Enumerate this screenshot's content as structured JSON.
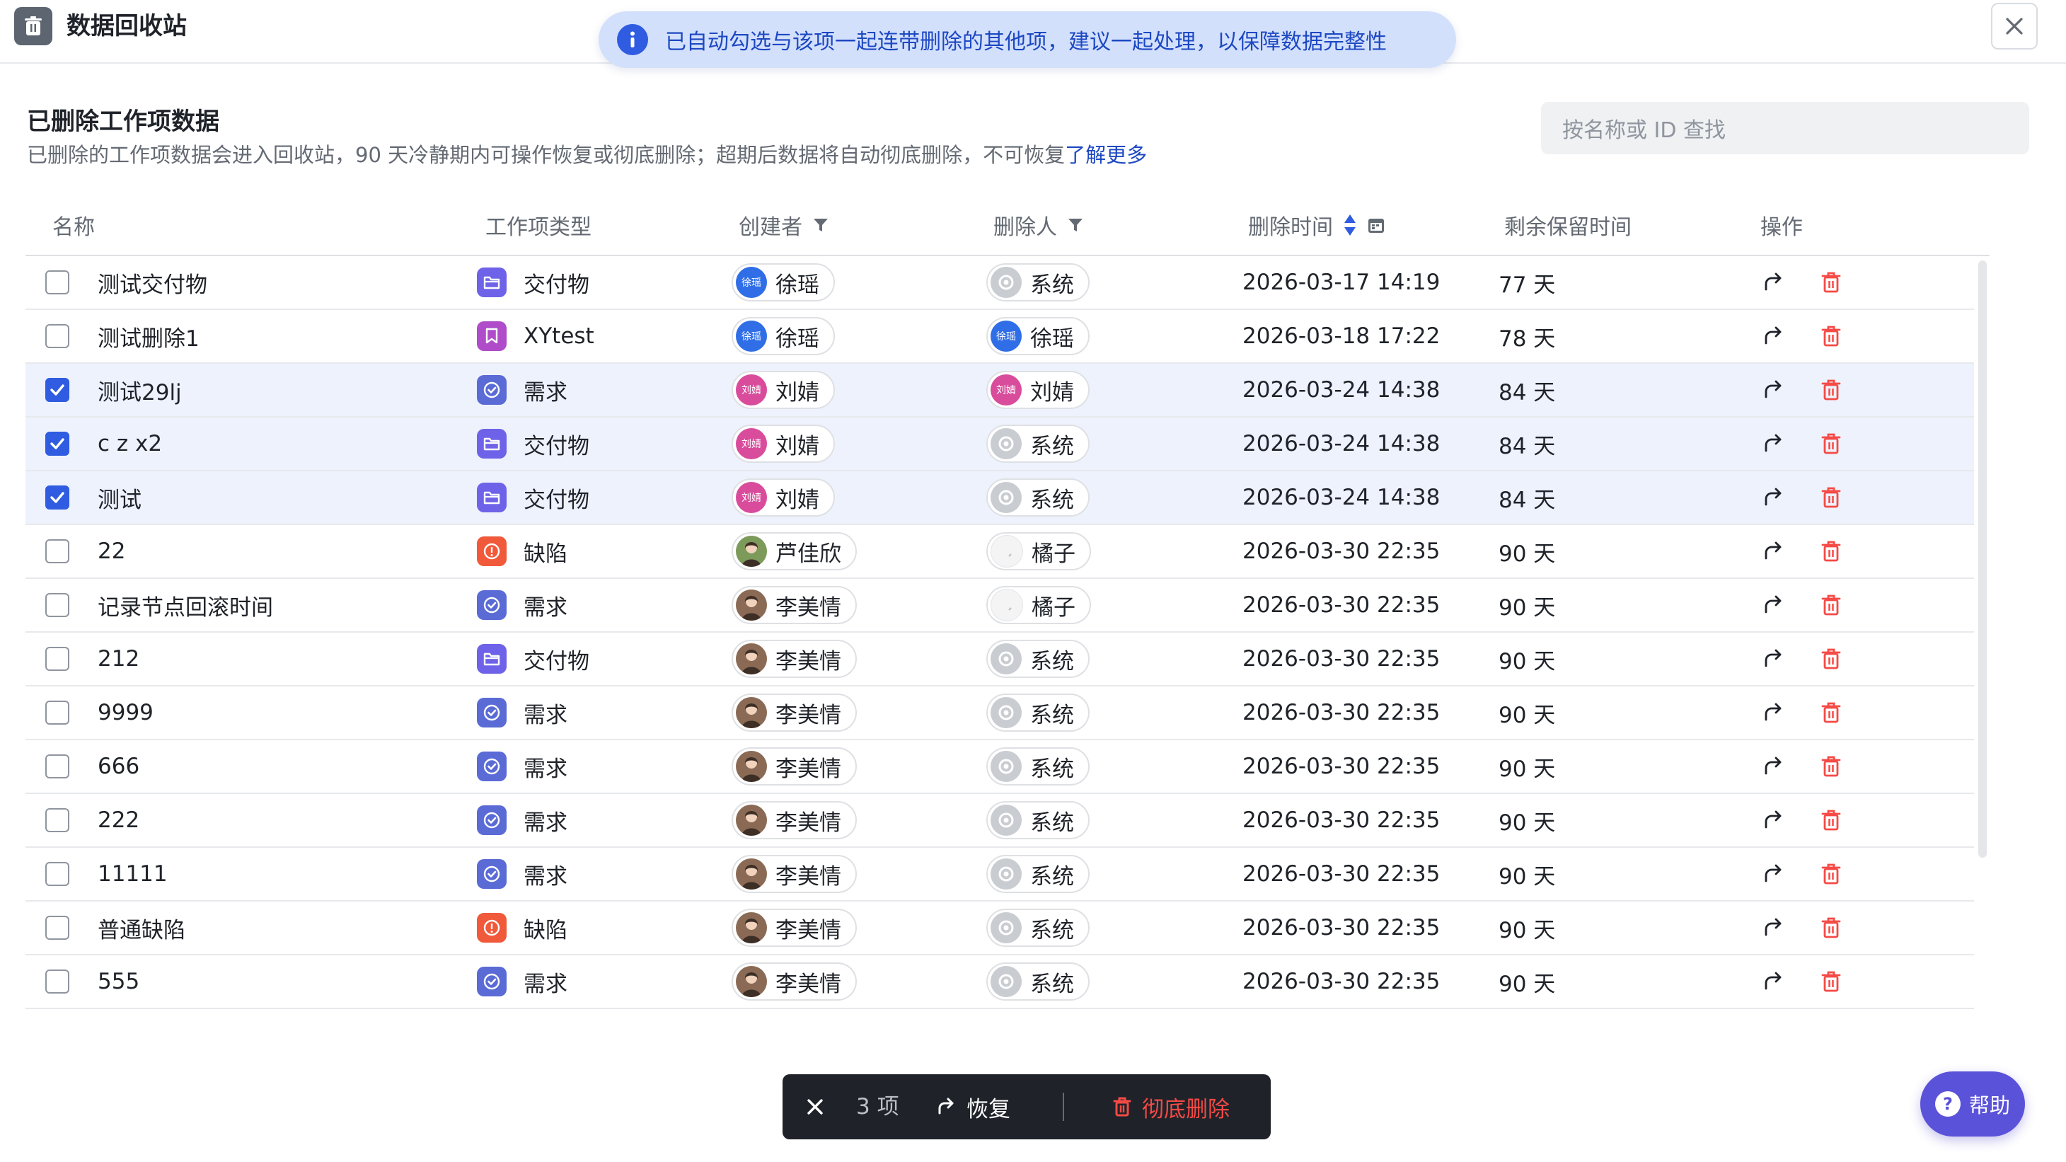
{
  "window": {
    "title": "数据回收站",
    "close_icon": "close-icon",
    "app_icon": "trash-icon"
  },
  "toast": {
    "icon": "info-icon",
    "text": "已自动勾选与该项一起连带删除的其他项，建议一起处理，以保障数据完整性"
  },
  "section": {
    "title": "已删除工作项数据",
    "description": "已删除的工作项数据会进入回收站，90 天冷静期内可操作恢复或彻底删除；超期后数据将自动彻底删除，不可恢复",
    "learn_more": "了解更多"
  },
  "search": {
    "placeholder": "按名称或 ID 查找"
  },
  "columns": {
    "name": "名称",
    "type": "工作项类型",
    "creator": "创建者",
    "deleter": "删除人",
    "deleted_at": "删除时间",
    "remaining": "剩余保留时间",
    "actions": "操作"
  },
  "type_colors": {
    "交付物": "#6e63e8",
    "XYtest": "#b04cc9",
    "需求": "#5a6bd6",
    "缺陷": "#f0593a"
  },
  "avatars": {
    "徐瑶": {
      "label": "徐瑶",
      "color": "#2f6ee6"
    },
    "刘婧": {
      "label": "刘婧",
      "color": "#d94c9c"
    },
    "芦佳欣": {
      "label": "",
      "color": "#7c9a5a"
    },
    "李美情": {
      "label": "",
      "color": "#8a6a54"
    },
    "系统": {
      "label": "",
      "color": "#c9ccd1"
    },
    "橘子": {
      "label": "",
      "color": "#f4f4f5"
    }
  },
  "rows": [
    {
      "name": "测试交付物",
      "type": "交付物",
      "creator": "徐瑶",
      "deleter": "系统",
      "deleted_at": "2026-03-17 14:19",
      "remaining": "77 天",
      "checked": false
    },
    {
      "name": "测试删除1",
      "type": "XYtest",
      "creator": "徐瑶",
      "deleter": "徐瑶",
      "deleted_at": "2026-03-18 17:22",
      "remaining": "78 天",
      "checked": false
    },
    {
      "name": "测试29lj",
      "type": "需求",
      "creator": "刘婧",
      "deleter": "刘婧",
      "deleted_at": "2026-03-24 14:38",
      "remaining": "84 天",
      "checked": true
    },
    {
      "name": "c z x2",
      "type": "交付物",
      "creator": "刘婧",
      "deleter": "系统",
      "deleted_at": "2026-03-24 14:38",
      "remaining": "84 天",
      "checked": true
    },
    {
      "name": "测试",
      "type": "交付物",
      "creator": "刘婧",
      "deleter": "系统",
      "deleted_at": "2026-03-24 14:38",
      "remaining": "84 天",
      "checked": true
    },
    {
      "name": "22",
      "type": "缺陷",
      "creator": "芦佳欣",
      "deleter": "橘子",
      "deleted_at": "2026-03-30 22:35",
      "remaining": "90 天",
      "checked": false
    },
    {
      "name": "记录节点回滚时间",
      "type": "需求",
      "creator": "李美情",
      "deleter": "橘子",
      "deleted_at": "2026-03-30 22:35",
      "remaining": "90 天",
      "checked": false
    },
    {
      "name": "212",
      "type": "交付物",
      "creator": "李美情",
      "deleter": "系统",
      "deleted_at": "2026-03-30 22:35",
      "remaining": "90 天",
      "checked": false
    },
    {
      "name": "9999",
      "type": "需求",
      "creator": "李美情",
      "deleter": "系统",
      "deleted_at": "2026-03-30 22:35",
      "remaining": "90 天",
      "checked": false
    },
    {
      "name": "666",
      "type": "需求",
      "creator": "李美情",
      "deleter": "系统",
      "deleted_at": "2026-03-30 22:35",
      "remaining": "90 天",
      "checked": false
    },
    {
      "name": "222",
      "type": "需求",
      "creator": "李美情",
      "deleter": "系统",
      "deleted_at": "2026-03-30 22:35",
      "remaining": "90 天",
      "checked": false
    },
    {
      "name": "11111",
      "type": "需求",
      "creator": "李美情",
      "deleter": "系统",
      "deleted_at": "2026-03-30 22:35",
      "remaining": "90 天",
      "checked": false
    },
    {
      "name": "普通缺陷",
      "type": "缺陷",
      "creator": "李美情",
      "deleter": "系统",
      "deleted_at": "2026-03-30 22:35",
      "remaining": "90 天",
      "checked": false
    },
    {
      "name": "555",
      "type": "需求",
      "creator": "李美情",
      "deleter": "系统",
      "deleted_at": "2026-03-30 22:35",
      "remaining": "90 天",
      "checked": false
    }
  ],
  "action_bar": {
    "count_text": "3 项",
    "restore_label": "恢复",
    "delete_label": "彻底删除"
  },
  "help": {
    "icon": "?",
    "label": "帮助"
  }
}
